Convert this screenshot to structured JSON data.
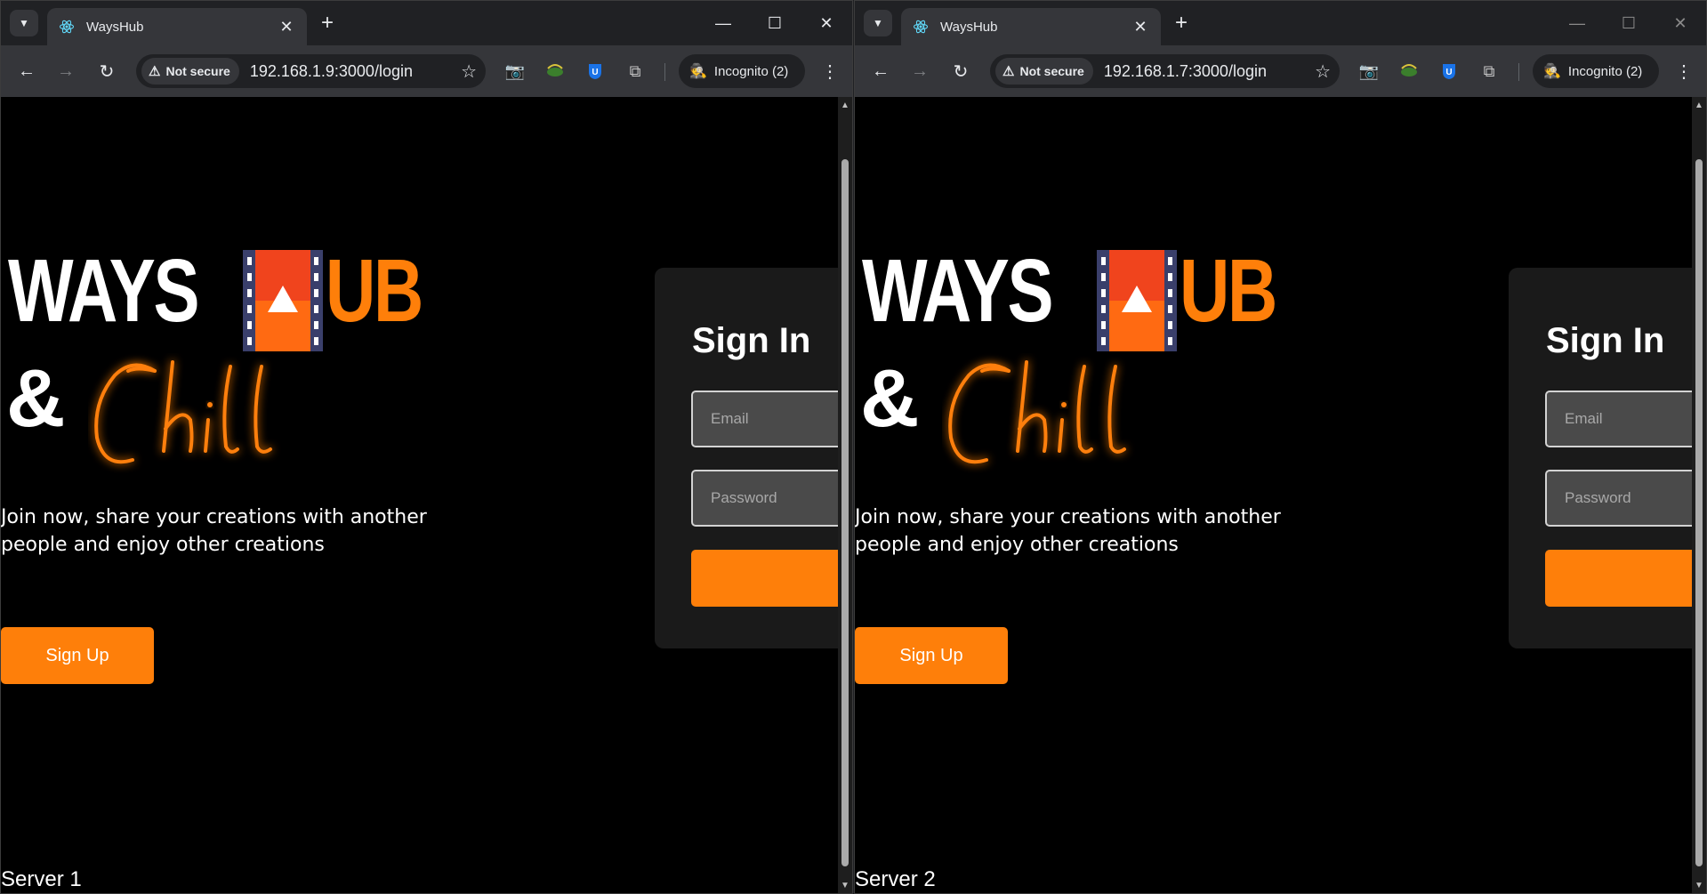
{
  "windows": [
    {
      "tab_title": "WaysHub",
      "security_label": "Not secure",
      "url": "192.168.1.9:3000/login",
      "incognito_label": "Incognito (2)",
      "server_label": "Server 1"
    },
    {
      "tab_title": "WaysHub",
      "security_label": "Not secure",
      "url": "192.168.1.7:3000/login",
      "incognito_label": "Incognito (2)",
      "server_label": "Server 2"
    }
  ],
  "page": {
    "logo": {
      "word1": "WAYS",
      "word2": "UB",
      "amp": "&",
      "script_word": "Chill"
    },
    "tagline": "Join now, share your creations with another people and enjoy other creations",
    "signup_label": "Sign Up",
    "signin": {
      "title": "Sign In",
      "email_placeholder": "Email",
      "password_placeholder": "Password",
      "submit_label": ""
    }
  },
  "colors": {
    "accent": "#fe7f0a",
    "page_bg": "#000000",
    "card_bg": "#1a1a1a",
    "chrome_tabstrip": "#202124",
    "chrome_toolbar": "#35363a"
  },
  "icons": {
    "tab_search": "chevron-down-icon",
    "favicon": "react-atom-icon",
    "close": "close-icon",
    "new_tab": "plus-icon",
    "back": "arrow-left-icon",
    "forward": "arrow-right-icon",
    "reload": "reload-icon",
    "security": "warning-triangle-icon",
    "bookmark": "star-icon",
    "extensions": [
      "camera-icon",
      "leaf-extension-icon",
      "u-shield-extension-icon",
      "puzzle-icon"
    ],
    "incognito": "incognito-icon",
    "menu": "kebab-menu-icon"
  }
}
